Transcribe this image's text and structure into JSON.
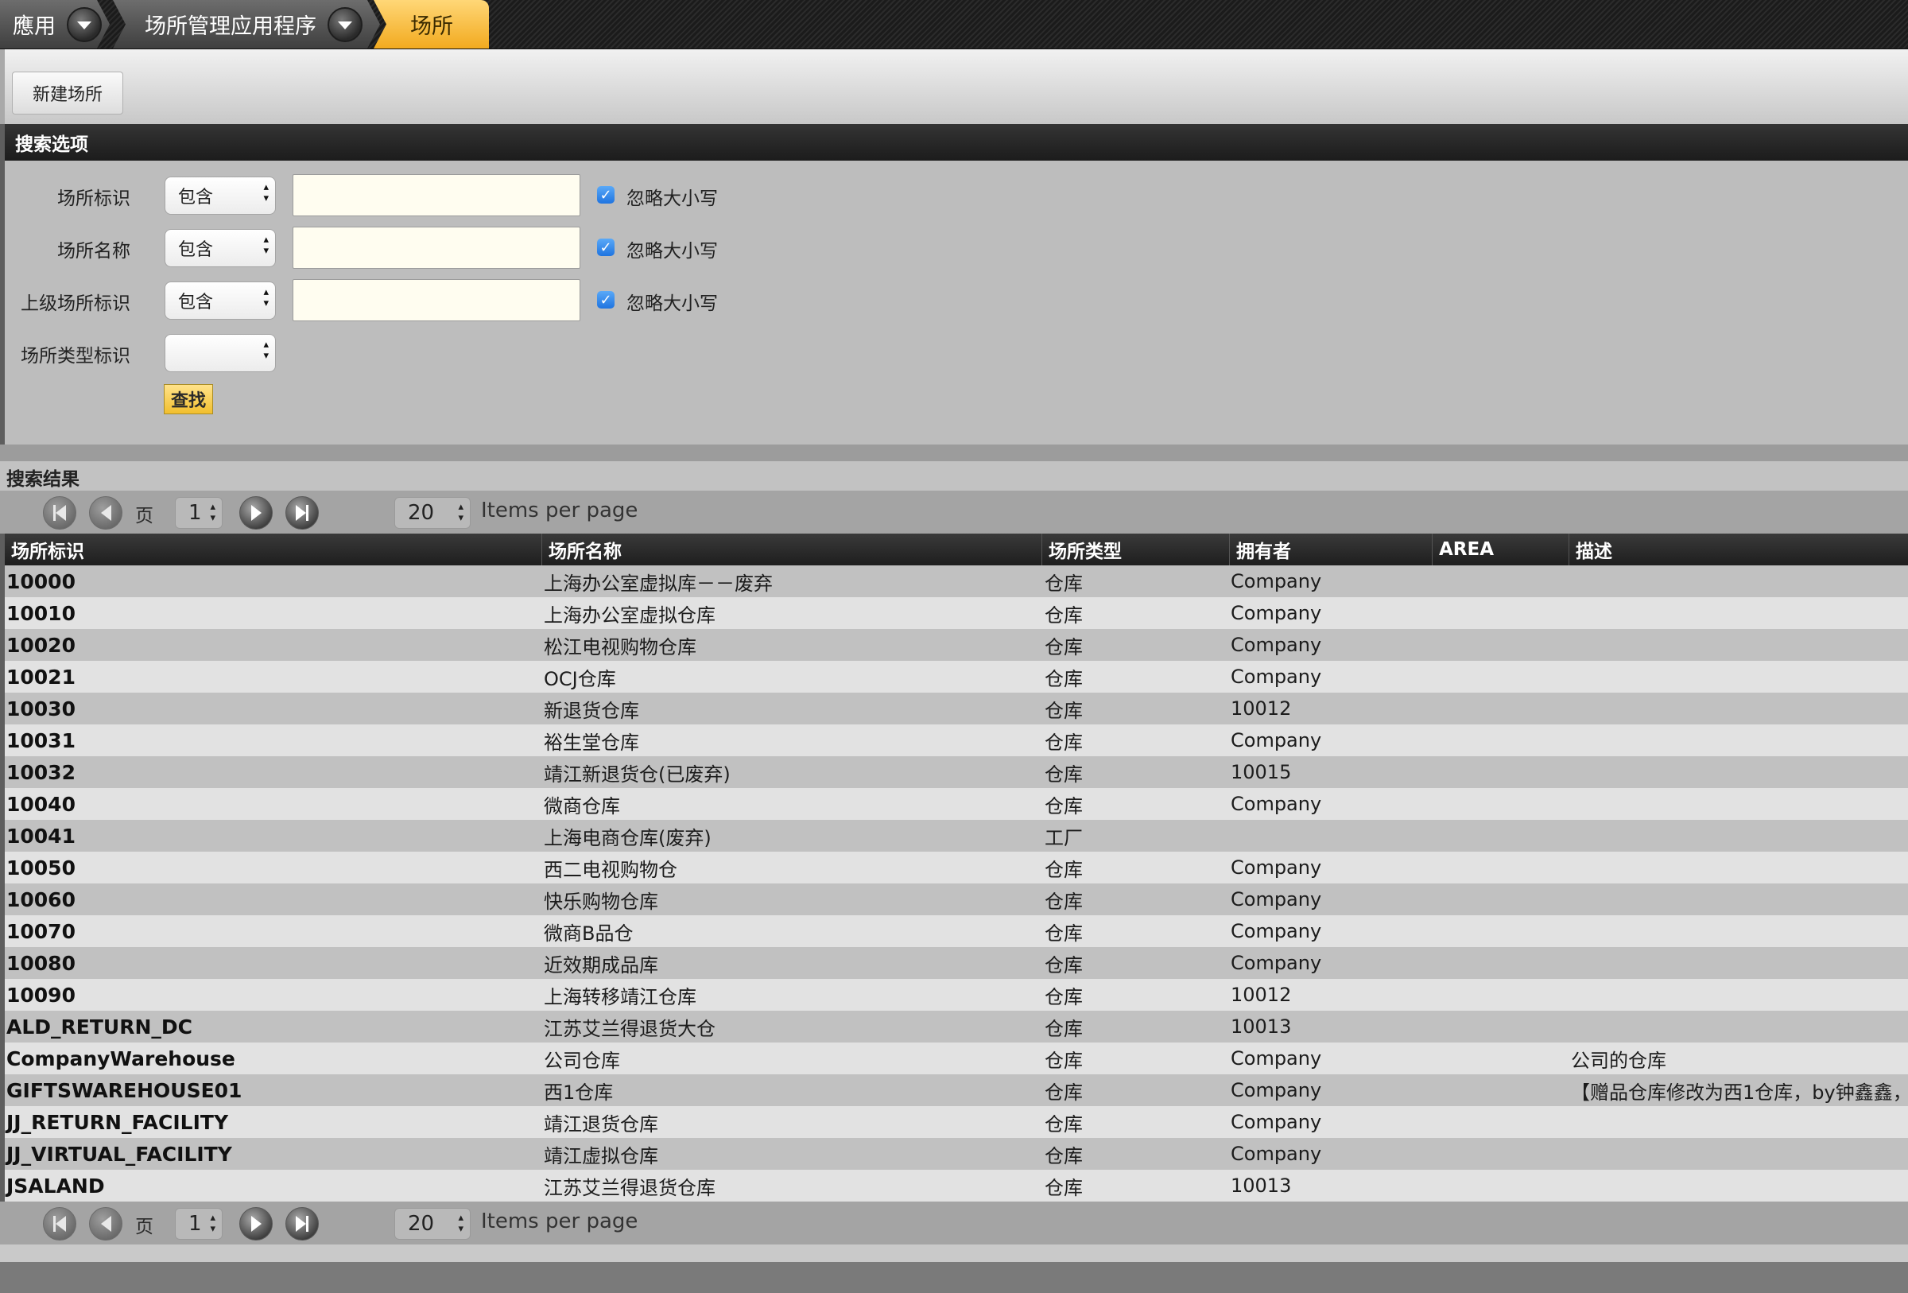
{
  "breadcrumbs": [
    {
      "label": "應用"
    },
    {
      "label": "场所管理应用程序"
    },
    {
      "label": "场所"
    }
  ],
  "toolbar": {
    "new_button": "新建场所"
  },
  "search_options": {
    "title": "搜索选项",
    "fields": [
      {
        "label": "场所标识",
        "operator": "包含",
        "value": "",
        "ignore_case_label": "忽略大小写",
        "ignore_case": true
      },
      {
        "label": "场所名称",
        "operator": "包含",
        "value": "",
        "ignore_case_label": "忽略大小写",
        "ignore_case": true
      },
      {
        "label": "上级场所标识",
        "operator": "包含",
        "value": "",
        "ignore_case_label": "忽略大小写",
        "ignore_case": true
      }
    ],
    "type_field": {
      "label": "场所类型标识",
      "value": ""
    },
    "find_button": "查找"
  },
  "results": {
    "title": "搜索结果",
    "pager": {
      "page_label": "页",
      "page": "1",
      "per_page": "20",
      "per_page_label": "Items per page"
    },
    "columns": [
      "场所标识",
      "场所名称",
      "场所类型",
      "拥有者",
      "AREA",
      "描述"
    ],
    "rows": [
      {
        "id": "10000",
        "name": "上海办公室虚拟库－－废弃",
        "type": "仓库",
        "owner": "Company",
        "area": "",
        "desc": ""
      },
      {
        "id": "10010",
        "name": "上海办公室虚拟仓库",
        "type": "仓库",
        "owner": "Company",
        "area": "",
        "desc": ""
      },
      {
        "id": "10020",
        "name": "松江电视购物仓库",
        "type": "仓库",
        "owner": "Company",
        "area": "",
        "desc": ""
      },
      {
        "id": "10021",
        "name": "OCJ仓库",
        "type": "仓库",
        "owner": "Company",
        "area": "",
        "desc": ""
      },
      {
        "id": "10030",
        "name": "新退货仓库",
        "type": "仓库",
        "owner": "10012",
        "area": "",
        "desc": ""
      },
      {
        "id": "10031",
        "name": "裕生堂仓库",
        "type": "仓库",
        "owner": "Company",
        "area": "",
        "desc": ""
      },
      {
        "id": "10032",
        "name": "靖江新退货仓(已废弃)",
        "type": "仓库",
        "owner": "10015",
        "area": "",
        "desc": ""
      },
      {
        "id": "10040",
        "name": "微商仓库",
        "type": "仓库",
        "owner": "Company",
        "area": "",
        "desc": ""
      },
      {
        "id": "10041",
        "name": "上海电商仓库(废弃)",
        "type": "工厂",
        "owner": "",
        "area": "",
        "desc": ""
      },
      {
        "id": "10050",
        "name": "西二电视购物仓",
        "type": "仓库",
        "owner": "Company",
        "area": "",
        "desc": ""
      },
      {
        "id": "10060",
        "name": "快乐购物仓库",
        "type": "仓库",
        "owner": "Company",
        "area": "",
        "desc": ""
      },
      {
        "id": "10070",
        "name": "微商B品仓",
        "type": "仓库",
        "owner": "Company",
        "area": "",
        "desc": ""
      },
      {
        "id": "10080",
        "name": "近效期成品库",
        "type": "仓库",
        "owner": "Company",
        "area": "",
        "desc": ""
      },
      {
        "id": "10090",
        "name": "上海转移靖江仓库",
        "type": "仓库",
        "owner": "10012",
        "area": "",
        "desc": ""
      },
      {
        "id": "ALD_RETURN_DC",
        "name": "江苏艾兰得退货大仓",
        "type": "仓库",
        "owner": "10013",
        "area": "",
        "desc": ""
      },
      {
        "id": "CompanyWarehouse",
        "name": "公司仓库",
        "type": "仓库",
        "owner": "Company",
        "area": "",
        "desc": "公司的仓库"
      },
      {
        "id": "GIFTSWAREHOUSE01",
        "name": "西1仓库",
        "type": "仓库",
        "owner": "Company",
        "area": "",
        "desc": "【赠品仓库修改为西1仓库，by钟鑫鑫，"
      },
      {
        "id": "JJ_RETURN_FACILITY",
        "name": "靖江退货仓库",
        "type": "仓库",
        "owner": "Company",
        "area": "",
        "desc": ""
      },
      {
        "id": "JJ_VIRTUAL_FACILITY",
        "name": "靖江虚拟仓库",
        "type": "仓库",
        "owner": "Company",
        "area": "",
        "desc": ""
      },
      {
        "id": "JSALAND",
        "name": "江苏艾兰得退货仓库",
        "type": "仓库",
        "owner": "10013",
        "area": "",
        "desc": ""
      }
    ]
  },
  "colors": {
    "accent_tab": "#f2aa1f",
    "header_dark": "#1e1e1e",
    "input_bg": "#fffdf0",
    "checkbox": "#1f74e0",
    "find_button": "#f1bf2e"
  }
}
